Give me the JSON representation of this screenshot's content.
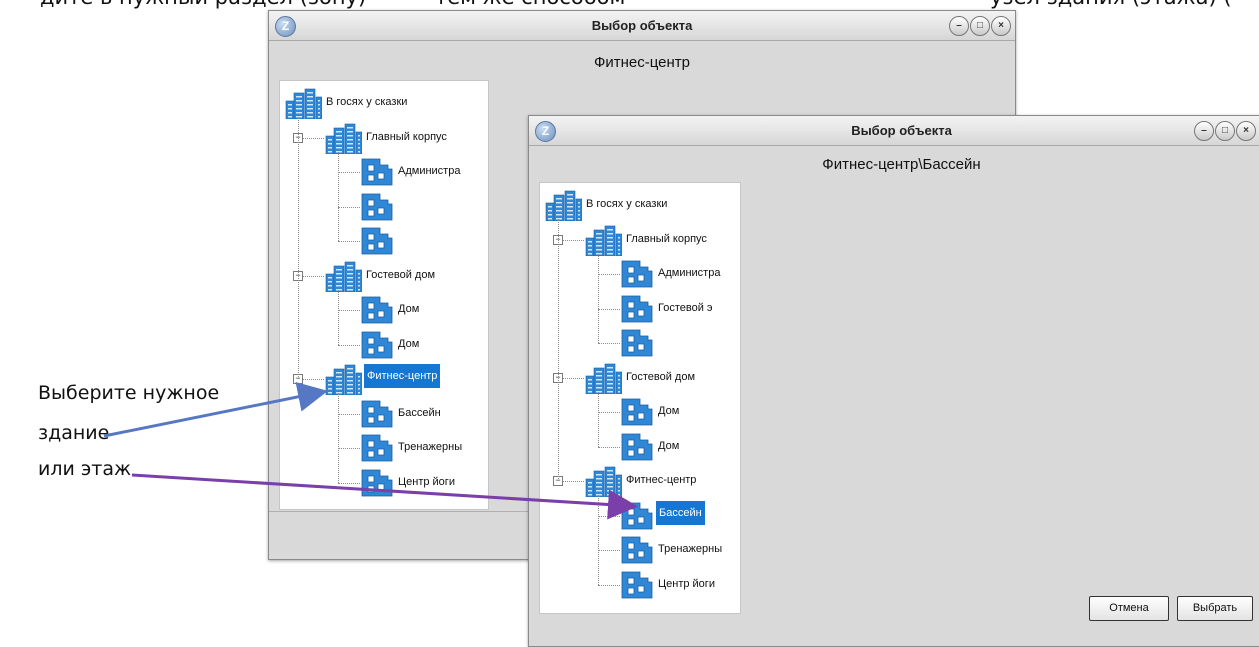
{
  "instruction_fragments": {
    "left": "дите в нужный раздел (зону)",
    "mid": "тем же способом",
    "right": "узел здания (этажа) ("
  },
  "callout": {
    "line1": "Выберите нужное",
    "line2": "здание",
    "line3": "или этаж"
  },
  "window_back": {
    "title": "Выбор объекта",
    "header": "Фитнес-центр",
    "controls": [
      "–",
      "□",
      "×"
    ],
    "tree": [
      {
        "label": "В госях у сказки",
        "icon": "building-icon",
        "selected": false
      },
      {
        "label": "Главный корпус",
        "icon": "building-icon",
        "selected": false
      },
      {
        "label": "Администра",
        "icon": "floor-icon",
        "selected": false
      },
      {
        "label": "",
        "icon": "floor-icon",
        "selected": false
      },
      {
        "label": "",
        "icon": "floor-icon",
        "selected": false
      },
      {
        "label": "Гостевой дом",
        "icon": "building-icon",
        "selected": false
      },
      {
        "label": "Дом",
        "icon": "floor-icon",
        "selected": false
      },
      {
        "label": "Дом",
        "icon": "floor-icon",
        "selected": false
      },
      {
        "label": "Фитнес-центр",
        "icon": "building-icon",
        "selected": true
      },
      {
        "label": "Бассейн",
        "icon": "floor-icon",
        "selected": false
      },
      {
        "label": "Тренажерны",
        "icon": "floor-icon",
        "selected": false
      },
      {
        "label": "Центр йоги",
        "icon": "floor-icon",
        "selected": false
      }
    ]
  },
  "window_front": {
    "title": "Выбор объекта",
    "header": "Фитнес-центр\\Бассейн",
    "controls": [
      "–",
      "□",
      "×"
    ],
    "tree": [
      {
        "label": "В госях у сказки",
        "icon": "building-icon",
        "selected": false
      },
      {
        "label": "Главный корпус",
        "icon": "building-icon",
        "selected": false
      },
      {
        "label": "Администра",
        "icon": "floor-icon",
        "selected": false
      },
      {
        "label": "Гостевой э",
        "icon": "floor-icon",
        "selected": false
      },
      {
        "label": "",
        "icon": "floor-icon",
        "selected": false
      },
      {
        "label": "Гостевой дом",
        "icon": "building-icon",
        "selected": false
      },
      {
        "label": "Дом",
        "icon": "floor-icon",
        "selected": false
      },
      {
        "label": "Дом",
        "icon": "floor-icon",
        "selected": false
      },
      {
        "label": "Фитнес-центр",
        "icon": "building-icon",
        "selected": false
      },
      {
        "label": "Бассейн",
        "icon": "floor-icon",
        "selected": true
      },
      {
        "label": "Тренажерны",
        "icon": "floor-icon",
        "selected": false
      },
      {
        "label": "Центр йоги",
        "icon": "floor-icon",
        "selected": false
      }
    ],
    "cancel_label": "Отмена",
    "select_label": "Выбрать"
  },
  "colors": {
    "selection": "#1577d2",
    "arrow_blue": "#5577c4",
    "arrow_purple": "#7a3fa8",
    "icon_blue": "#2f87d6"
  }
}
